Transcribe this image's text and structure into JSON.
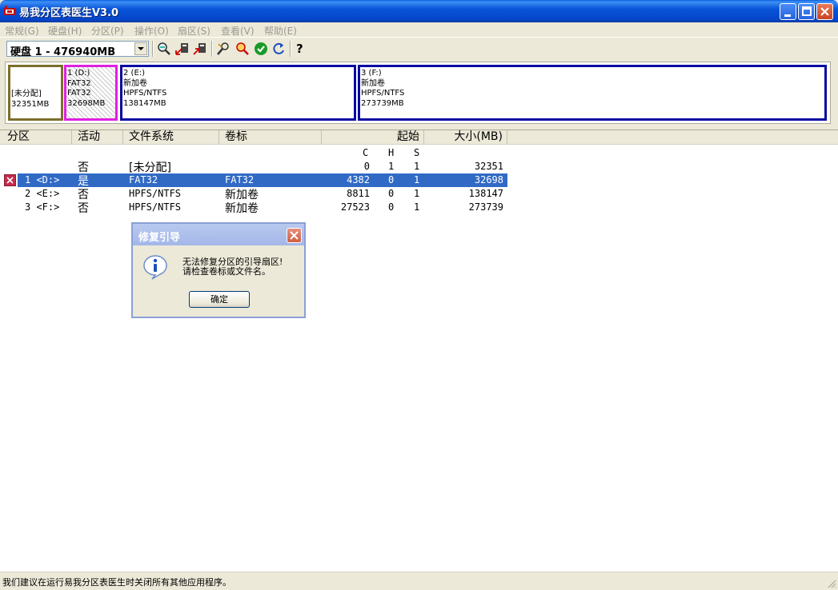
{
  "window": {
    "title": "易我分区表医生V3.0",
    "buttons": {
      "minimize": "minimize",
      "maximize": "maximize",
      "close": "close"
    }
  },
  "menu": [
    {
      "label": "常规(G)"
    },
    {
      "label": "硬盘(H)"
    },
    {
      "label": "分区(P)"
    },
    {
      "label": "操作(O)"
    },
    {
      "label": "扇区(S)"
    },
    {
      "label": "查看(V)"
    },
    {
      "label": "帮助(E)"
    }
  ],
  "toolbar": {
    "disk_selected": "硬盘 1 - 476940MB",
    "help_label": "?"
  },
  "partition_map": {
    "unallocated": {
      "line1": "[未分配]",
      "line2": "32351MB"
    },
    "d": {
      "line1": "1 (D:)",
      "line2": "FAT32",
      "line3": "FAT32",
      "line4": "32698MB"
    },
    "e": {
      "line1": "2 (E:)",
      "line2": "新加卷",
      "line3": "HPFS/NTFS",
      "line4": "138147MB"
    },
    "f": {
      "line1": "3 (F:)",
      "line2": "新加卷",
      "line3": "HPFS/NTFS",
      "line4": "273739MB"
    }
  },
  "list": {
    "headers": {
      "partition": "分区",
      "active": "活动",
      "filesystem": "文件系统",
      "label": "卷标",
      "start": "起始",
      "size": "大小(MB)"
    },
    "subheaders": {
      "c": "C",
      "h": "H",
      "s": "S"
    },
    "rows": [
      {
        "partition": "",
        "active": "否",
        "fs": "[未分配]",
        "label": "",
        "c": "0",
        "h": "1",
        "s": "1",
        "size": "32351"
      },
      {
        "partition": "1 <D:>",
        "active": "是",
        "fs": "FAT32",
        "label": "FAT32",
        "c": "4382",
        "h": "0",
        "s": "1",
        "size": "32698"
      },
      {
        "partition": "2 <E:>",
        "active": "否",
        "fs": "HPFS/NTFS",
        "label": "新加卷",
        "c": "8811",
        "h": "0",
        "s": "1",
        "size": "138147"
      },
      {
        "partition": "3 <F:>",
        "active": "否",
        "fs": "HPFS/NTFS",
        "label": "新加卷",
        "c": "27523",
        "h": "0",
        "s": "1",
        "size": "273739"
      }
    ]
  },
  "dialog": {
    "title": "修复引导",
    "message_line1": "无法修复分区的引导扇区!",
    "message_line2": "请检查卷标或文件名。",
    "ok_label": "确定"
  },
  "status": {
    "text": "我们建议在运行易我分区表医生时关闭所有其他应用程序。"
  },
  "colors": {
    "titlebar": "#0854d8",
    "selection": "#316ac5",
    "unallocated_border": "#7b6f2b",
    "fat32_border": "#e020e0",
    "ntfs_border": "#0a0aa0"
  }
}
